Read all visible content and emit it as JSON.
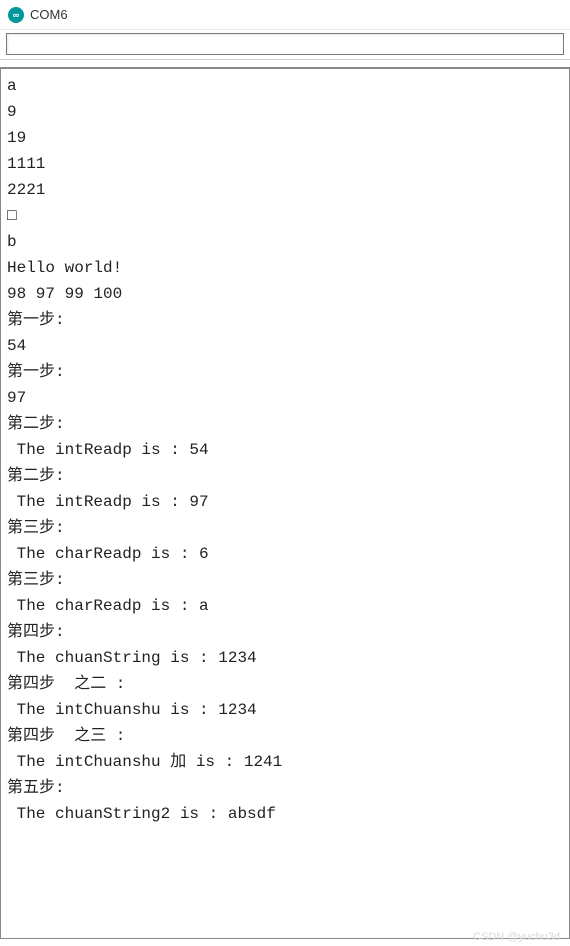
{
  "window": {
    "title": "COM6",
    "icon_glyph": "∞"
  },
  "input": {
    "value": "",
    "placeholder": ""
  },
  "console_lines": [
    "a",
    "9",
    "19",
    "1111",
    "2221",
    "□",
    "b",
    "Hello world!",
    "98 97 99 100",
    "第一步:",
    "54",
    "第一步:",
    "97",
    "第二步:",
    " The intReadp is : 54",
    "第二步:",
    " The intReadp is : 97",
    "第三步:",
    " The charReadp is : 6",
    "第三步:",
    " The charReadp is : a",
    "第四步:",
    " The chuanString is : 1234",
    "第四步  之二 :",
    " The intChuanshu is : 1234",
    "第四步  之三 :",
    " The intChuanshu 加 is : 1241",
    "第五步:",
    " The chuanString2 is : absdf"
  ],
  "watermark": "CSDN @yuchu3d"
}
